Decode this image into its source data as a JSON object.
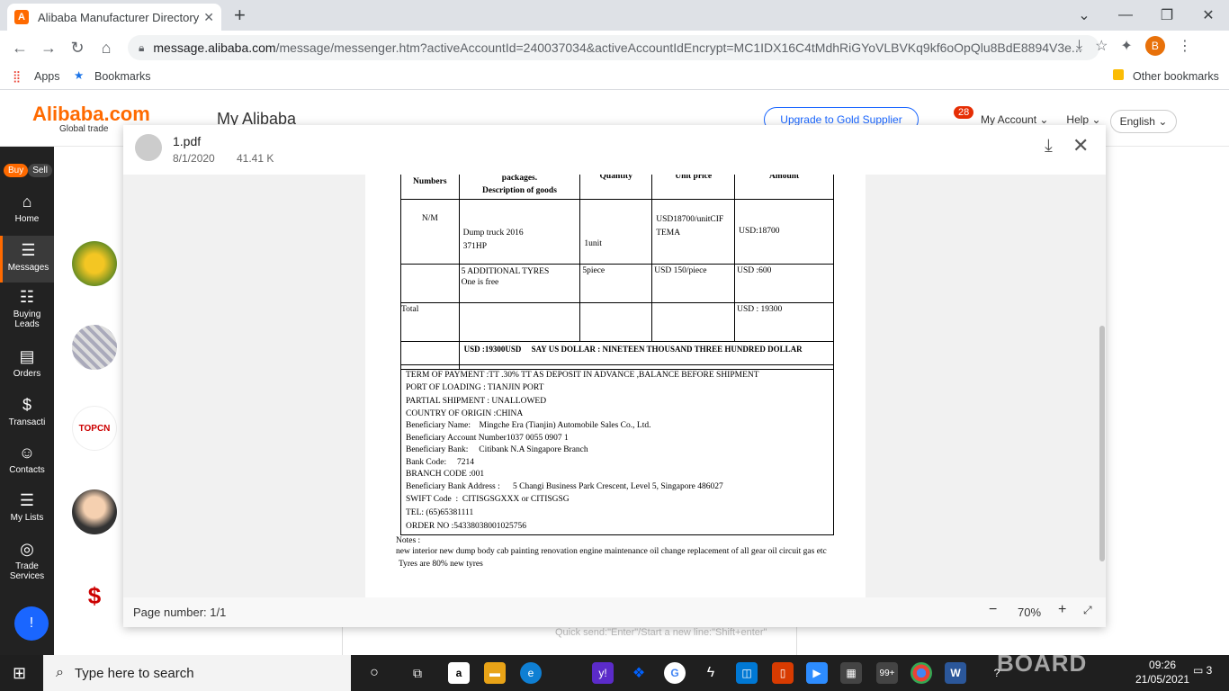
{
  "browser": {
    "tab_title": "Alibaba Manufacturer Directory",
    "tab_close": "✕",
    "new_tab": "+",
    "url_host": "message.alibaba.com",
    "url_path": "/message/messenger.htm?activeAccountId=240037034&activeAccountIdEncrypt=MC1IDX16C4tMdhRiGYoVLBVKq9kf6oOpQlu8BdE8894V3e...",
    "profile_letter": "B",
    "bookmarks": {
      "apps": "Apps",
      "bookmarks": "Bookmarks",
      "other": "Other bookmarks"
    }
  },
  "alibaba": {
    "logo": "Alibaba.com",
    "logo_sub": "Global trade",
    "section_title": "My Alibaba",
    "upgrade": "Upgrade to Gold Supplier",
    "notif_count": "28",
    "my_account": "My Account",
    "help": "Help",
    "language": "English"
  },
  "sidebar": {
    "buy": "Buy",
    "sell": "Sell",
    "items": [
      {
        "label": "Home",
        "icon": "⌂"
      },
      {
        "label": "Messages",
        "icon": "☰"
      },
      {
        "label": "Buying Leads",
        "icon": "☷"
      },
      {
        "label": "Orders",
        "icon": "▤"
      },
      {
        "label": "Transacti",
        "icon": "$"
      },
      {
        "label": "Contacts",
        "icon": "☺"
      },
      {
        "label": "My Lists",
        "icon": "☰"
      },
      {
        "label": "Trade Services",
        "icon": "◎"
      }
    ]
  },
  "viewer": {
    "file_name": "1.pdf",
    "file_date": "8/1/2020",
    "file_size": "41.41 K",
    "page_number": "Page number: 1/1",
    "zoom": "70%",
    "zoom_out": "−",
    "zoom_in": "+"
  },
  "invoice": {
    "header": [
      "Numbers",
      "packages.\nDescription of goods",
      "Quantity",
      "Unit price",
      "Amount"
    ],
    "rows": [
      [
        "N/M",
        "Dump truck 2016\n371HP",
        "1unit",
        "USD18700/unitCIF\nTEMA",
        "USD:18700"
      ],
      [
        "",
        "5 ADDITIONAL TYRES\nOne is free",
        "5piece",
        "USD 150/piece",
        "USD :600"
      ],
      [
        "Total",
        "",
        "",
        "",
        "USD : 19300"
      ]
    ],
    "say": "USD :19300USD     SAY US DOLLAR : NINETEEN THOUSAND THREE HUNDRED DOLLAR",
    "terms": [
      "TERM OF PAYMENT :TT .30% TT AS DEPOSIT IN ADVANCE ,BALANCE BEFORE SHIPMENT",
      "PORT OF LOADING : TIANJIN PORT",
      "PARTIAL SHIPMENT : UNALLOWED",
      "COUNTRY OF ORIGIN :CHINA",
      "Beneficiary Name:    Mingche Era (Tianjin) Automobile Sales Co., Ltd.",
      "Beneficiary Account Number1037 0055 0907 1",
      "Beneficiary Bank:     Citibank N.A Singapore Branch",
      "Bank Code:     7214",
      "BRANCH CODE :001",
      "Beneficiary Bank Address :      5 Changi Business Park Crescent, Level 5, Singapore 486027",
      "SWIFT Code  :  CITISGSGXXX or CITISGSG",
      "TEL: (65)65381111",
      "ORDER NO :54338038001025756"
    ],
    "notes_title": "Notes  :",
    "notes_body": "new interior new dump body cab painting renovation engine maintenance oil change replacement of all gear oil circuit gas  etc",
    "notes_tyres": "Tyres are 80% new tyres"
  },
  "chat_hint": "Quick send:\"Enter\"/Start a new line:\"Shift+enter\"",
  "taskbar": {
    "search_placeholder": "Type here to search",
    "time": "09:26",
    "date": "21/05/2021",
    "mail_count": "99+",
    "notif": "3",
    "watermark": "BOARD"
  }
}
